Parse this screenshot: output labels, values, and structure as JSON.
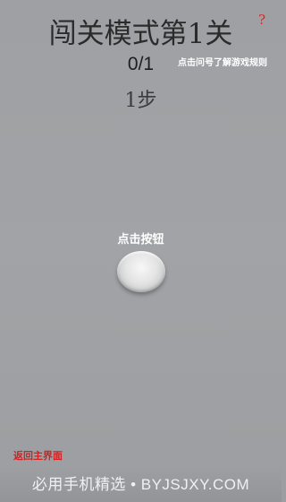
{
  "header": {
    "title": "闯关模式第1关",
    "help_mark": "?",
    "help_hint": "点击问号了解游戏规则"
  },
  "status": {
    "progress": "0/1",
    "steps": "1步"
  },
  "game": {
    "button_label": "点击按钮"
  },
  "footer": {
    "back_label": "返回主界面",
    "watermark": "必用手机精选 • BYJSJXY.COM"
  },
  "colors": {
    "background": "#a0a2a5",
    "accent_red": "#d42a2a",
    "title_text": "#2b2b2b"
  }
}
